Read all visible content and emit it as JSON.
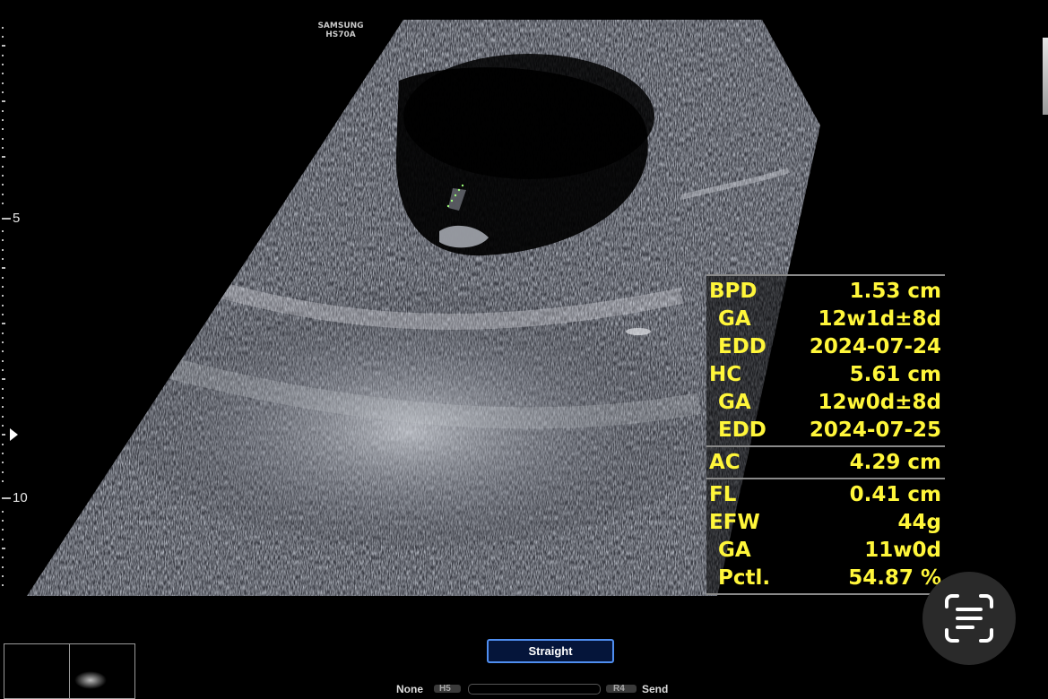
{
  "device": {
    "brand": "SAMSUNG",
    "model": "HS70A"
  },
  "depth_scale": {
    "labels": [
      "5",
      "10"
    ]
  },
  "results": {
    "groups": [
      {
        "rows": [
          {
            "label": "BPD",
            "value": "1.53 cm",
            "sub": false
          },
          {
            "label": "GA",
            "value": "12w1d±8d",
            "sub": true
          },
          {
            "label": "EDD",
            "value": "2024-07-24",
            "sub": true
          },
          {
            "label": "HC",
            "value": "5.61 cm",
            "sub": false
          },
          {
            "label": "GA",
            "value": "12w0d±8d",
            "sub": true
          },
          {
            "label": "EDD",
            "value": "2024-07-25",
            "sub": true
          }
        ]
      },
      {
        "rows": [
          {
            "label": "AC",
            "value": "4.29 cm",
            "sub": false
          }
        ]
      },
      {
        "rows": [
          {
            "label": "FL",
            "value": "0.41 cm",
            "sub": false
          },
          {
            "label": "EFW",
            "value": "44g",
            "sub": false
          },
          {
            "label": "GA",
            "value": "11w0d",
            "sub": true
          },
          {
            "label": "Pctl.",
            "value": "54.87 %",
            "sub": true
          }
        ]
      }
    ],
    "text_color": "#fff63a"
  },
  "controls": {
    "mode_button": "Straight",
    "bottom_left_label": "None",
    "bottom_left_pill": "H5",
    "bottom_right_pill": "R4",
    "bottom_right_label": "Send"
  },
  "icons": {
    "scan": "text-scan-icon",
    "focus": "focus-marker-icon"
  },
  "colors": {
    "accent_blue": "#4f8ef0",
    "background": "#000000"
  }
}
